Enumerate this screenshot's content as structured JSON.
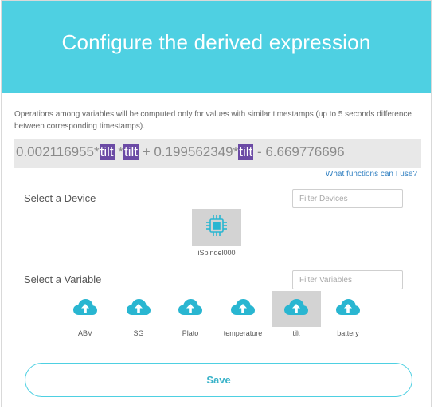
{
  "header": {
    "title": "Configure the derived expression"
  },
  "note": "Operations among variables will be computed only for values with similar timestamps (up to 5 seconds difference between corresponding timestamps).",
  "expression": {
    "parts": [
      {
        "text": "0.002116955*",
        "chip": false
      },
      {
        "text": "tilt",
        "chip": true
      },
      {
        "text": " *",
        "chip": false
      },
      {
        "text": "tilt",
        "chip": true
      },
      {
        "text": " + 0.199562349*",
        "chip": false
      },
      {
        "text": "tilt",
        "chip": true
      },
      {
        "text": " - 6.669776696",
        "chip": false
      }
    ]
  },
  "help_link": "What functions can I use?",
  "device_section": {
    "label": "Select a Device",
    "filter_placeholder": "Filter Devices",
    "devices": [
      {
        "name": "iSpindel000",
        "icon": "chip-icon",
        "selected": true
      }
    ]
  },
  "variable_section": {
    "label": "Select a Variable",
    "filter_placeholder": "Filter Variables",
    "variables": [
      {
        "name": "ABV",
        "icon": "cloud-upload-icon",
        "selected": false
      },
      {
        "name": "SG",
        "icon": "cloud-upload-icon",
        "selected": false
      },
      {
        "name": "Plato",
        "icon": "cloud-upload-icon",
        "selected": false
      },
      {
        "name": "temperature",
        "icon": "cloud-upload-icon",
        "selected": false
      },
      {
        "name": "tilt",
        "icon": "cloud-upload-icon",
        "selected": true
      },
      {
        "name": "battery",
        "icon": "cloud-upload-icon",
        "selected": false
      }
    ]
  },
  "save_label": "Save",
  "colors": {
    "header": "#4ed0e2",
    "accent": "#29b6d1",
    "variable_chip": "#6b4aa5",
    "selected_bg": "#d3d3d3"
  }
}
